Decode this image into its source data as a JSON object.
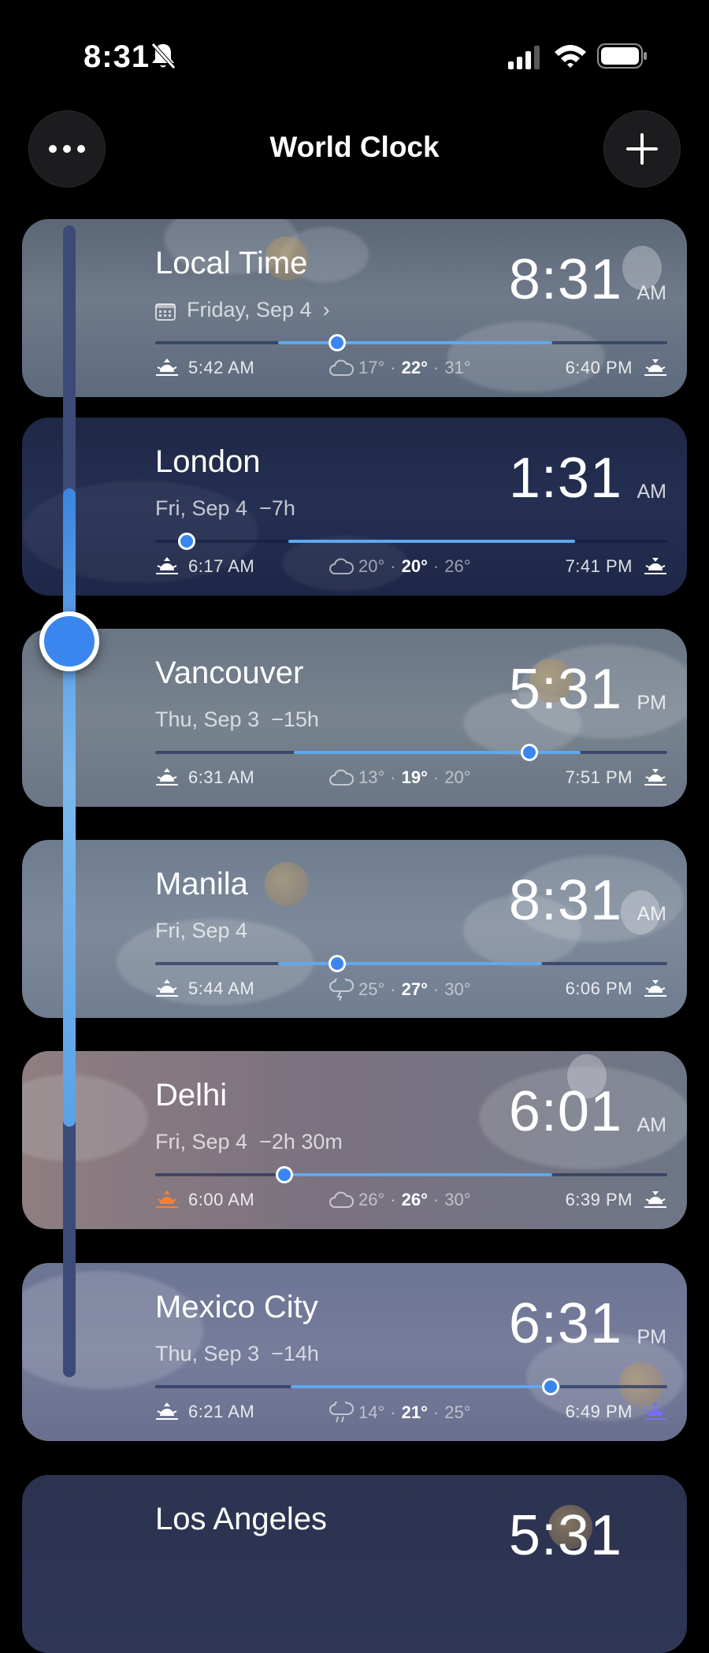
{
  "status_bar": {
    "time": "8:31"
  },
  "header": {
    "title": "World Clock"
  },
  "cards": [
    {
      "city": "Local Time",
      "date": "Friday, Sep 4",
      "time": "8:31",
      "ampm": "AM",
      "sunrise": "5:42 AM",
      "sunset": "6:40 PM",
      "temp_low": "17°",
      "temp_now": "22°",
      "temp_high": "31°",
      "day_progress": 0.355,
      "day_start": 0.24,
      "day_end": 0.775,
      "weather": "cloud"
    },
    {
      "city": "London",
      "date": "Fri, Sep 4",
      "offset": "−7h",
      "time": "1:31",
      "ampm": "AM",
      "sunrise": "6:17 AM",
      "sunset": "7:41 PM",
      "temp_low": "20°",
      "temp_now": "20°",
      "temp_high": "26°",
      "day_progress": 0.062,
      "day_start": 0.26,
      "day_end": 0.82,
      "weather": "cloud"
    },
    {
      "city": "Vancouver",
      "date": "Thu, Sep 3",
      "offset": "−15h",
      "time": "5:31",
      "ampm": "PM",
      "sunrise": "6:31 AM",
      "sunset": "7:51 PM",
      "temp_low": "13°",
      "temp_now": "19°",
      "temp_high": "20°",
      "day_progress": 0.73,
      "day_start": 0.27,
      "day_end": 0.83,
      "weather": "cloud"
    },
    {
      "city": "Manila",
      "date": "Fri, Sep 4",
      "time": "8:31",
      "ampm": "AM",
      "sunrise": "5:44 AM",
      "sunset": "6:06 PM",
      "temp_low": "25°",
      "temp_now": "27°",
      "temp_high": "30°",
      "day_progress": 0.355,
      "day_start": 0.24,
      "day_end": 0.755,
      "weather": "storm"
    },
    {
      "city": "Delhi",
      "date": "Fri, Sep 4",
      "offset": "−2h 30m",
      "time": "6:01",
      "ampm": "AM",
      "sunrise": "6:00 AM",
      "sunset": "6:39 PM",
      "temp_low": "26°",
      "temp_now": "26°",
      "temp_high": "30°",
      "day_progress": 0.252,
      "day_start": 0.25,
      "day_end": 0.775,
      "weather": "cloud"
    },
    {
      "city": "Mexico City",
      "date": "Thu, Sep 3",
      "offset": "−14h",
      "time": "6:31",
      "ampm": "PM",
      "sunrise": "6:21 AM",
      "sunset": "6:49 PM",
      "temp_low": "14°",
      "temp_now": "21°",
      "temp_high": "25°",
      "day_progress": 0.772,
      "day_start": 0.265,
      "day_end": 0.79,
      "weather": "rain"
    },
    {
      "city": "Los Angeles",
      "time": "5:31"
    }
  ],
  "colors": {
    "accent": "#3b86ee",
    "sunrise_orange": "#f0823c",
    "sunset_purple": "#7a6cf0"
  }
}
